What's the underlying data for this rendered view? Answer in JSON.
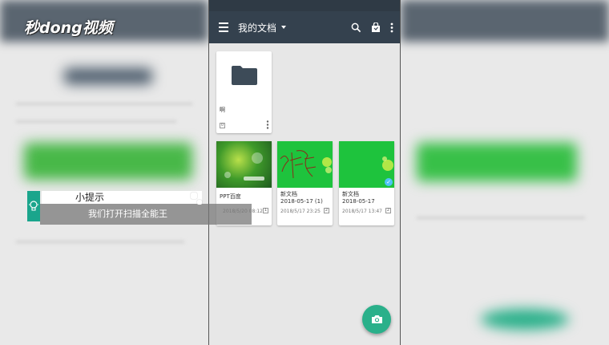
{
  "watermark": {
    "logo_text": "秒dong视频"
  },
  "app": {
    "title": "我的文档",
    "icons": [
      "menu-icon",
      "caret-down-icon",
      "search-icon",
      "bag-icon",
      "more-vert-icon"
    ],
    "accent": "#34414e",
    "fab_color": "#2ab08a"
  },
  "folder": {
    "name": "啊",
    "count_badge": "0"
  },
  "documents": [
    {
      "name": "PPT百度",
      "date": "2018/5/20 08:12",
      "pages": "1"
    },
    {
      "name": "新文档",
      "name2": "2018-05-17 (1)",
      "date": "2018/5/17 23:25",
      "pages": "2"
    },
    {
      "name": "新文档",
      "name2": "2018-05-17",
      "date": "2018/5/17 13:47",
      "pages": "2"
    }
  ],
  "tip": {
    "title": "小提示",
    "text": "我们打开扫描全能王"
  }
}
